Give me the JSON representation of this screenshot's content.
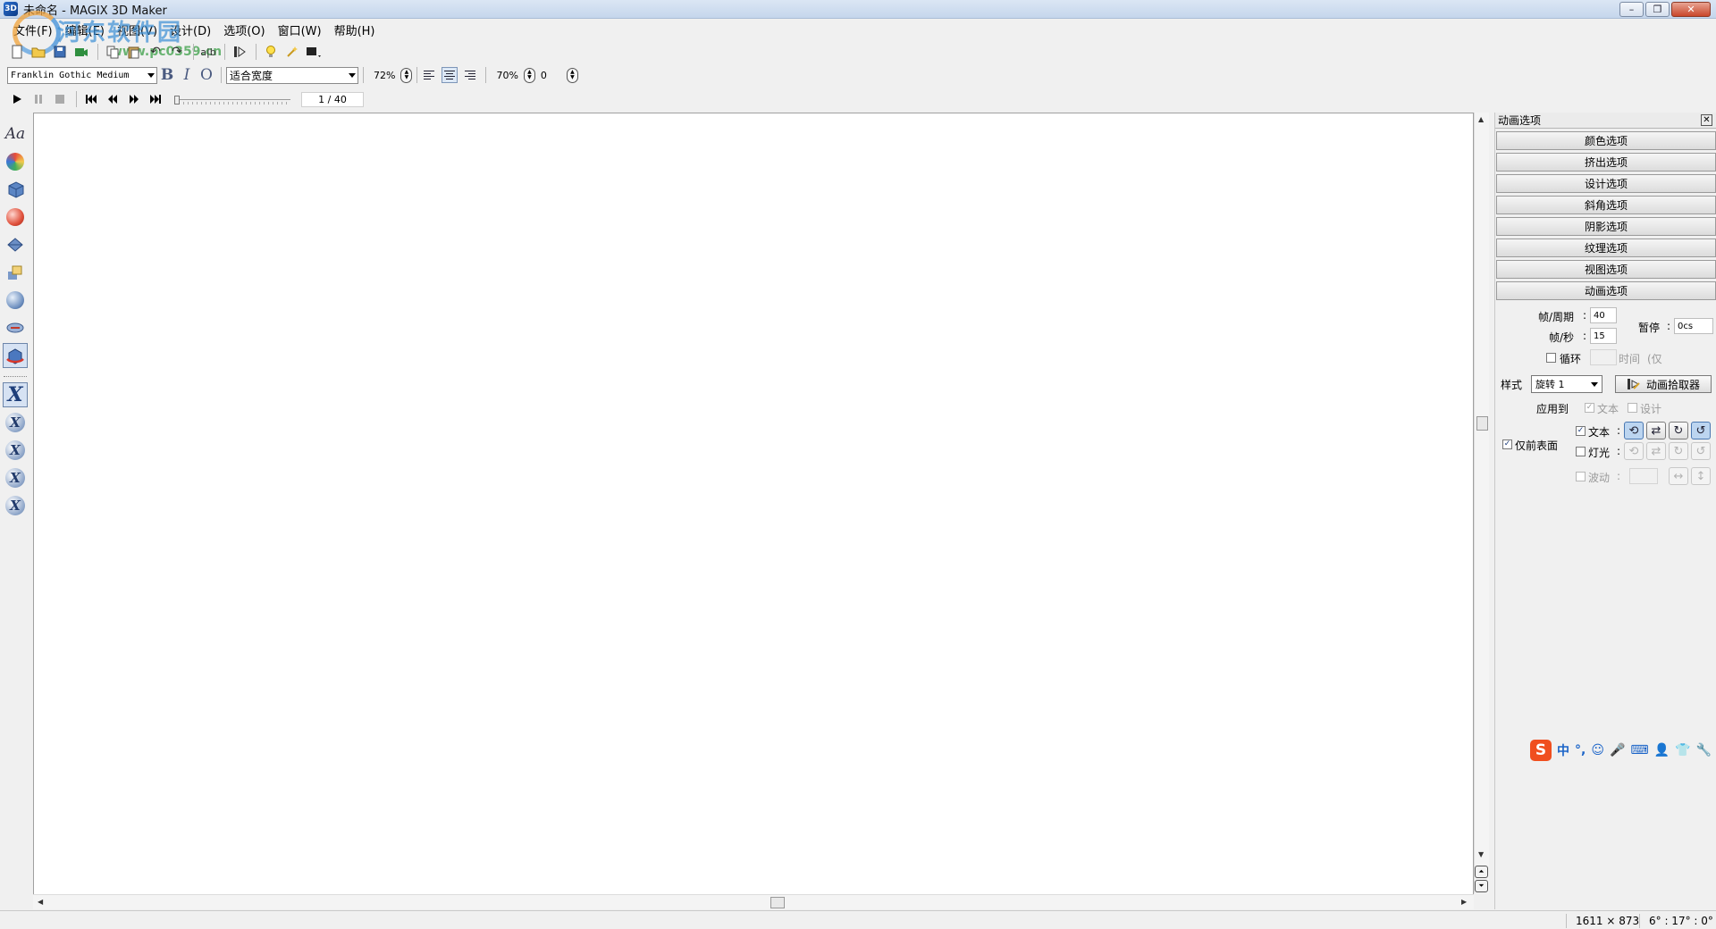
{
  "window": {
    "title": "未命名 - MAGIX 3D Maker",
    "app_icon": "3D",
    "minimize": "–",
    "restore": "❐",
    "close": "✕"
  },
  "watermark": {
    "name": "河东软件园",
    "url": "www.pc0359.cn"
  },
  "menu": [
    "文件(F)",
    "编辑(E)",
    "视图(V)",
    "设计(D)",
    "选项(O)",
    "窗口(W)",
    "帮助(H)"
  ],
  "toolbar2": {
    "font": "Franklin Gothic Medium",
    "bold": "B",
    "italic": "I",
    "outline": "O",
    "fit": "适合宽度",
    "zoom1": "72%",
    "zoom2": "70%",
    "value3": "0"
  },
  "toolbar3": {
    "frame_counter": "1 / 40"
  },
  "left_tools": {
    "text_icon": "Aa"
  },
  "panel": {
    "title": "动画选项",
    "close": "✕",
    "sections": [
      "颜色选项",
      "挤出选项",
      "设计选项",
      "斜角选项",
      "阴影选项",
      "纹理选项",
      "视图选项",
      "动画选项"
    ],
    "frames_per_cycle_label": "帧/周期",
    "frames_per_cycle_value": "40",
    "fps_label": "帧/秒",
    "fps_value": "15",
    "pause_label": "暂停",
    "pause_value": "0cs",
    "colon": ":",
    "loop_label": "循环",
    "time_label": "时间",
    "time_suffix": "(仅",
    "style_label": "样式",
    "style_value": "旋转 1",
    "picker_button": "动画拾取器",
    "apply_to_label": "应用到",
    "apply_text": "文本",
    "apply_design": "设计",
    "front_only": "仅前表面",
    "row_text_label": "文本",
    "row_light_label": "灯光",
    "row_wave_label": "波动"
  },
  "ime": {
    "logo": "S",
    "items": [
      "中",
      "°,",
      "☺",
      "🎤",
      "⌨",
      "👤",
      "👕",
      "🔧"
    ]
  },
  "status": {
    "dimensions": "1611 × 873",
    "angles": "6° : 17° : 0°"
  }
}
